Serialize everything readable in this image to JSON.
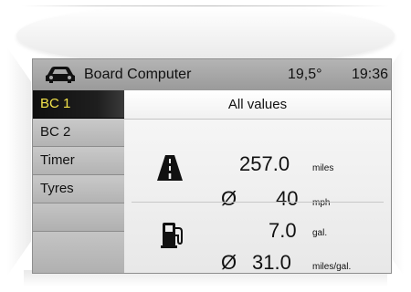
{
  "header": {
    "app_icon": "car-icon",
    "title": "Board Computer",
    "temperature": "19,5°",
    "clock": "19:36"
  },
  "menu": {
    "items": [
      {
        "label": "BC 1",
        "active": true
      },
      {
        "label": "BC 2",
        "active": false
      },
      {
        "label": "Timer",
        "active": false
      },
      {
        "label": "Tyres",
        "active": false
      },
      {
        "label": "",
        "active": false
      },
      {
        "label": "",
        "active": false
      }
    ]
  },
  "main": {
    "heading": "All values",
    "trip": {
      "icon": "road-icon",
      "distance_value": "257.0",
      "distance_unit": "miles",
      "avg_symbol": "Ø",
      "avg_speed_value": "40",
      "avg_speed_unit": "mph"
    },
    "fuel": {
      "icon": "fuel-pump-icon",
      "consumed_value": "7.0",
      "consumed_unit": "gal.",
      "avg_symbol": "Ø",
      "avg_consumption_value": "31.0",
      "avg_consumption_unit": "miles/gal."
    }
  },
  "colors": {
    "active_menu_text": "#f2e24a",
    "active_menu_bg": "#101010",
    "titlebar_bg": "#a8a8a8"
  }
}
